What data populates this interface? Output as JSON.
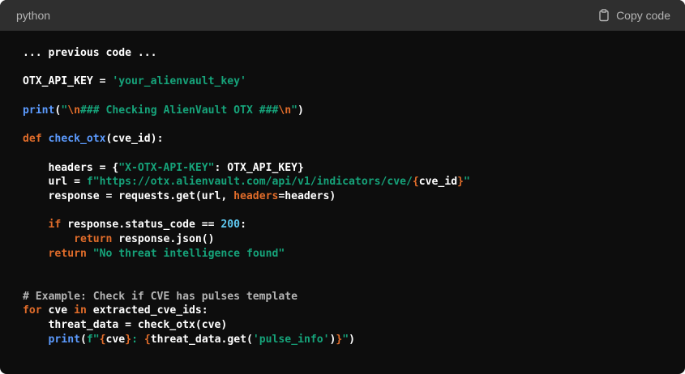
{
  "header": {
    "language": "python",
    "copy_label": "Copy code"
  },
  "icons": {
    "copy": "clipboard-icon"
  },
  "colors": {
    "background": "#0d0d0d",
    "header_background": "#2f2f2f",
    "keyword": "#e06c2a",
    "function": "#5c9bff",
    "string": "#16a37a",
    "number": "#5ec8f0",
    "comment": "#b4b4b4",
    "text": "#ffffff"
  },
  "code_lines": [
    [
      {
        "t": "... previous code ...",
        "c": "plain"
      }
    ],
    [],
    [
      {
        "t": "OTX_API_KEY = ",
        "c": "plain"
      },
      {
        "t": "'your_alienvault_key'",
        "c": "str"
      }
    ],
    [],
    [
      {
        "t": "print",
        "c": "fn"
      },
      {
        "t": "(",
        "c": "plain"
      },
      {
        "t": "\"",
        "c": "str"
      },
      {
        "t": "\\n",
        "c": "esc"
      },
      {
        "t": "### Checking AlienVault OTX ###",
        "c": "str"
      },
      {
        "t": "\\n",
        "c": "esc"
      },
      {
        "t": "\"",
        "c": "str"
      },
      {
        "t": ")",
        "c": "plain"
      }
    ],
    [],
    [
      {
        "t": "def ",
        "c": "kw"
      },
      {
        "t": "check_otx",
        "c": "fn"
      },
      {
        "t": "(cve_id):",
        "c": "plain"
      }
    ],
    [],
    [
      {
        "t": "    headers = {",
        "c": "plain"
      },
      {
        "t": "\"X-OTX-API-KEY\"",
        "c": "str"
      },
      {
        "t": ": OTX_API_KEY}",
        "c": "plain"
      }
    ],
    [
      {
        "t": "    url = ",
        "c": "plain"
      },
      {
        "t": "f\"https://otx.alienvault.com/api/v1/indicators/cve/",
        "c": "str"
      },
      {
        "t": "{",
        "c": "kw"
      },
      {
        "t": "cve_id",
        "c": "plain"
      },
      {
        "t": "}",
        "c": "kw"
      },
      {
        "t": "\"",
        "c": "str"
      }
    ],
    [
      {
        "t": "    response = requests.get(url, ",
        "c": "plain"
      },
      {
        "t": "headers",
        "c": "param"
      },
      {
        "t": "=headers)",
        "c": "plain"
      }
    ],
    [],
    [
      {
        "t": "    ",
        "c": "plain"
      },
      {
        "t": "if",
        "c": "kw"
      },
      {
        "t": " response.status_code == ",
        "c": "plain"
      },
      {
        "t": "200",
        "c": "num"
      },
      {
        "t": ":",
        "c": "plain"
      }
    ],
    [
      {
        "t": "        ",
        "c": "plain"
      },
      {
        "t": "return",
        "c": "kw"
      },
      {
        "t": " response.json()",
        "c": "plain"
      }
    ],
    [
      {
        "t": "    ",
        "c": "plain"
      },
      {
        "t": "return",
        "c": "kw"
      },
      {
        "t": " ",
        "c": "plain"
      },
      {
        "t": "\"No threat intelligence found\"",
        "c": "str"
      }
    ],
    [],
    [],
    [
      {
        "t": "# Example: Check if CVE has pulses template",
        "c": "cmt"
      }
    ],
    [
      {
        "t": "for",
        "c": "kw"
      },
      {
        "t": " cve ",
        "c": "plain"
      },
      {
        "t": "in",
        "c": "kw"
      },
      {
        "t": " extracted_cve_ids:",
        "c": "plain"
      }
    ],
    [
      {
        "t": "    threat_data = check_otx(cve)",
        "c": "plain"
      }
    ],
    [
      {
        "t": "    ",
        "c": "plain"
      },
      {
        "t": "print",
        "c": "fn"
      },
      {
        "t": "(",
        "c": "plain"
      },
      {
        "t": "f\"",
        "c": "str"
      },
      {
        "t": "{",
        "c": "kw"
      },
      {
        "t": "cve",
        "c": "plain"
      },
      {
        "t": "}",
        "c": "kw"
      },
      {
        "t": ": ",
        "c": "str"
      },
      {
        "t": "{",
        "c": "kw"
      },
      {
        "t": "threat_data.get(",
        "c": "plain"
      },
      {
        "t": "'pulse_info'",
        "c": "str"
      },
      {
        "t": ")",
        "c": "plain"
      },
      {
        "t": "}",
        "c": "kw"
      },
      {
        "t": "\"",
        "c": "str"
      },
      {
        "t": ")",
        "c": "plain"
      }
    ]
  ]
}
